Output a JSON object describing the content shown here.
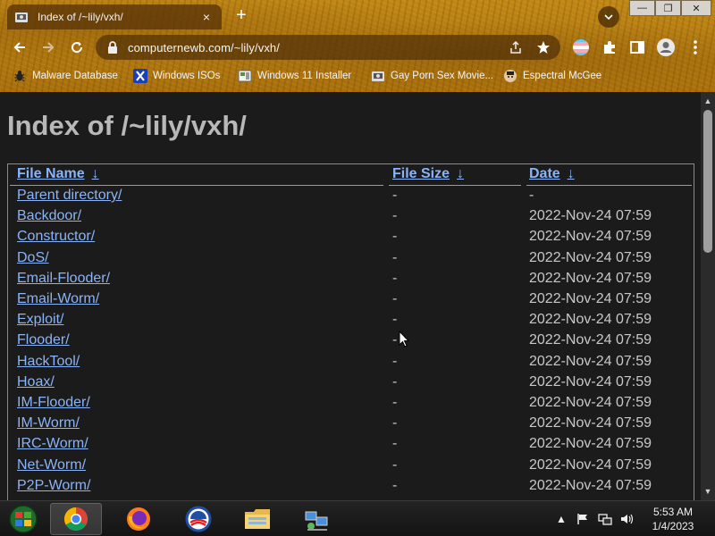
{
  "browser": {
    "tab_title": "Index of /~lily/vxh/",
    "tab_close": "×",
    "new_tab": "+",
    "url": "computernewb.com/~lily/vxh/",
    "window_controls": {
      "minimize": "—",
      "maximize": "❐",
      "close": "✕"
    }
  },
  "bookmarks": [
    {
      "label": "Malware Database",
      "icon": "bug-icon"
    },
    {
      "label": "Windows ISOs",
      "icon": "x-logo-icon"
    },
    {
      "label": "Windows 11 Installer",
      "icon": "image-icon"
    },
    {
      "label": "Gay Porn Sex Movie...",
      "icon": "site-icon"
    },
    {
      "label": "Espectral McGee",
      "icon": "avatar-icon"
    }
  ],
  "page": {
    "title": "Index of /~lily/vxh/",
    "columns": {
      "name": "File Name",
      "size": "File Size",
      "date": "Date",
      "sort_arrow": "↓"
    },
    "rows": [
      {
        "name": "Parent directory/",
        "size": "-",
        "date": "-"
      },
      {
        "name": "Backdoor/",
        "size": "-",
        "date": "2022-Nov-24 07:59"
      },
      {
        "name": "Constructor/",
        "size": "-",
        "date": "2022-Nov-24 07:59"
      },
      {
        "name": "DoS/",
        "size": "-",
        "date": "2022-Nov-24 07:59"
      },
      {
        "name": "Email-Flooder/",
        "size": "-",
        "date": "2022-Nov-24 07:59"
      },
      {
        "name": "Email-Worm/",
        "size": "-",
        "date": "2022-Nov-24 07:59"
      },
      {
        "name": "Exploit/",
        "size": "-",
        "date": "2022-Nov-24 07:59"
      },
      {
        "name": "Flooder/",
        "size": "-",
        "date": "2022-Nov-24 07:59"
      },
      {
        "name": "HackTool/",
        "size": "-",
        "date": "2022-Nov-24 07:59"
      },
      {
        "name": "Hoax/",
        "size": "-",
        "date": "2022-Nov-24 07:59"
      },
      {
        "name": "IM-Flooder/",
        "size": "-",
        "date": "2022-Nov-24 07:59"
      },
      {
        "name": "IM-Worm/",
        "size": "-",
        "date": "2022-Nov-24 07:59"
      },
      {
        "name": "IRC-Worm/",
        "size": "-",
        "date": "2022-Nov-24 07:59"
      },
      {
        "name": "Net-Worm/",
        "size": "-",
        "date": "2022-Nov-24 07:59"
      },
      {
        "name": "P2P-Worm/",
        "size": "-",
        "date": "2022-Nov-24 07:59"
      },
      {
        "name": "",
        "size": "",
        "date": ""
      }
    ]
  },
  "taskbar": {
    "apps": [
      "chrome",
      "firefox",
      "obama",
      "file-explorer",
      "network"
    ],
    "time": "5:53 AM",
    "date": "1/4/2023"
  },
  "colors": {
    "link": "#8ab4f8",
    "page_bg": "#1b1b1b",
    "chrome_bg": "#b57c12"
  }
}
